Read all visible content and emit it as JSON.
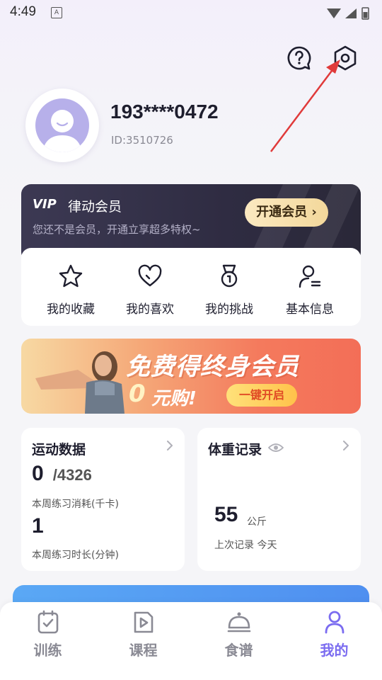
{
  "status_bar": {
    "time": "4:49",
    "a_badge": "A"
  },
  "profile": {
    "phone": "193****0472",
    "id_text": "ID:3510726"
  },
  "vip": {
    "logo": "VIP",
    "title": "律动会员",
    "subtitle": "您还不是会员，开通立享超多特权~",
    "button": "开通会员 ›"
  },
  "quick_actions": [
    {
      "label": "我的收藏",
      "icon": "star-icon"
    },
    {
      "label": "我的喜欢",
      "icon": "heart-icon"
    },
    {
      "label": "我的挑战",
      "icon": "medal-icon"
    },
    {
      "label": "基本信息",
      "icon": "user-info-icon"
    }
  ],
  "banner": {
    "headline": "免费得终身会员",
    "zero": "0",
    "buy": "元购!",
    "button": "一键开启"
  },
  "sports": {
    "title": "运动数据",
    "calories_value": "0",
    "calories_target": "/4326",
    "calories_label": "本周练习消耗(千卡)",
    "duration_value": "1",
    "duration_label": "本周练习时长(分钟)"
  },
  "weight": {
    "title": "体重记录",
    "value": "55",
    "unit": "公斤",
    "last": "上次记录 今天"
  },
  "tabs": [
    {
      "label": "训练",
      "icon": "training-icon"
    },
    {
      "label": "课程",
      "icon": "course-icon"
    },
    {
      "label": "食谱",
      "icon": "recipe-icon"
    },
    {
      "label": "我的",
      "icon": "profile-icon",
      "active": true
    }
  ],
  "colors": {
    "accent": "#7b6cf0",
    "vip_bg": "#33304a",
    "vip_button": "#f6dca5",
    "arrow": "#e03a3a"
  }
}
